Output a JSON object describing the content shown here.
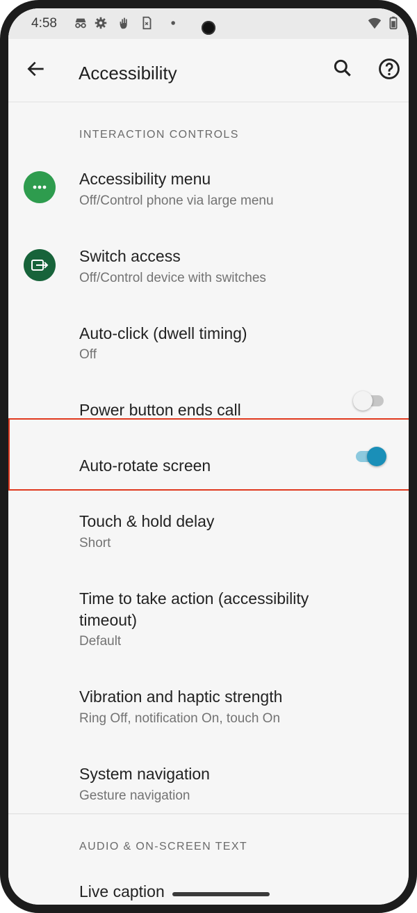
{
  "status_bar": {
    "time": "4:58",
    "icons": [
      "incognito-icon",
      "settings-gear-icon",
      "hand-icon",
      "sim-icon",
      "dot-icon",
      "wifi-icon",
      "battery-icon"
    ]
  },
  "app_bar": {
    "title": "Accessibility",
    "back_icon": "arrow-back-icon",
    "search_icon": "search-icon",
    "help_icon": "help-icon"
  },
  "sections": [
    {
      "header": "INTERACTION CONTROLS",
      "items": [
        {
          "title": "Accessibility menu",
          "subtitle": "Off/Control phone via large menu",
          "icon": "accessibility-menu-icon"
        },
        {
          "title": "Switch access",
          "subtitle": "Off/Control device with switches",
          "icon": "switch-access-icon"
        },
        {
          "title": "Auto-click (dwell timing)",
          "subtitle": "Off"
        },
        {
          "title": "Power button ends call",
          "toggle": false
        },
        {
          "title": "Auto-rotate screen",
          "toggle": true
        },
        {
          "title": "Touch & hold delay",
          "subtitle": "Short"
        },
        {
          "title_line1": "Time to take action (accessibility",
          "title_line2": "timeout)",
          "subtitle": "Default"
        },
        {
          "title": "Vibration and haptic strength",
          "subtitle": "Ring Off, notification On, touch On"
        },
        {
          "title": "System navigation",
          "subtitle": "Gesture navigation"
        }
      ]
    },
    {
      "header": "AUDIO & ON-SCREEN TEXT",
      "items": [
        {
          "title": "Live caption"
        }
      ]
    }
  ],
  "colors": {
    "accent": "#1a8fb8",
    "accent_track": "#8cc9de",
    "menu_icon_bg": "#2e9c4e",
    "switch_icon_bg": "#17633a",
    "highlight": "#e0391e"
  }
}
